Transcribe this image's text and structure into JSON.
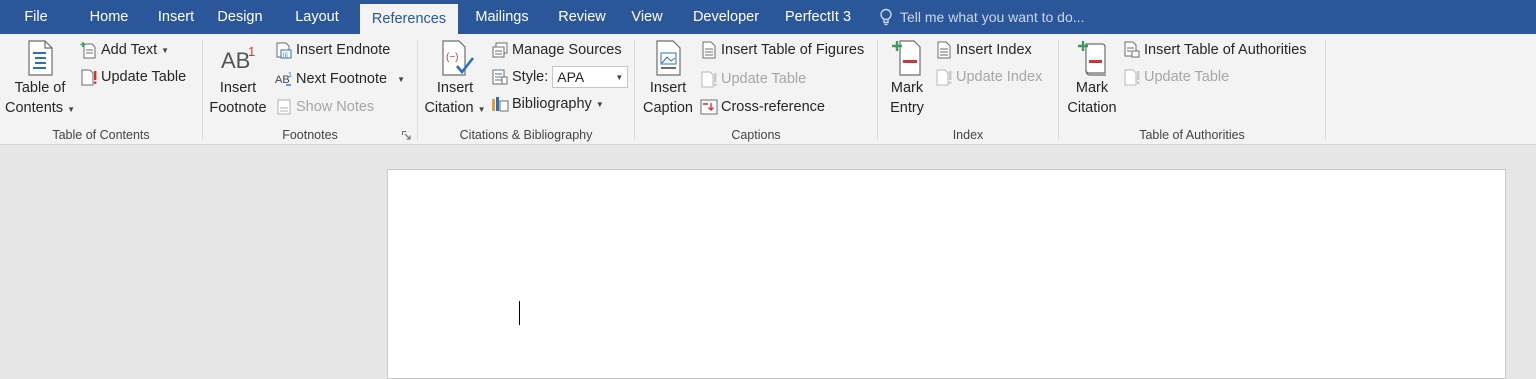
{
  "tabs": [
    {
      "label": "File",
      "active": false
    },
    {
      "label": "Home",
      "active": false
    },
    {
      "label": "Insert",
      "active": false
    },
    {
      "label": "Design",
      "active": false
    },
    {
      "label": "Layout",
      "active": false
    },
    {
      "label": "References",
      "active": true
    },
    {
      "label": "Mailings",
      "active": false
    },
    {
      "label": "Review",
      "active": false
    },
    {
      "label": "View",
      "active": false
    },
    {
      "label": "Developer",
      "active": false
    },
    {
      "label": "PerfectIt 3",
      "active": false
    }
  ],
  "tell_me": {
    "placeholder": "Tell me what you want to do...",
    "icon": "lightbulb-icon"
  },
  "colors": {
    "tab_bar": "#2b579a",
    "ribbon": "#f3f3f3",
    "accent_red": "#d13438",
    "accent_green": "#3a9a5b",
    "accent_blue": "#2b6fc2"
  },
  "groups": {
    "toc": {
      "label": "Table of Contents",
      "table_of_contents": {
        "line1": "Table of",
        "line2": "Contents"
      },
      "add_text": "Add Text",
      "update_table": "Update Table"
    },
    "footnotes": {
      "label": "Footnotes",
      "insert_footnote": {
        "line1": "Insert",
        "line2": "Footnote"
      },
      "insert_endnote": "Insert Endnote",
      "next_footnote": "Next Footnote",
      "show_notes": "Show Notes"
    },
    "citations": {
      "label": "Citations & Bibliography",
      "insert_citation": {
        "line1": "Insert",
        "line2": "Citation"
      },
      "manage_sources": "Manage Sources",
      "style_label": "Style:",
      "style_value": "APA",
      "bibliography": "Bibliography"
    },
    "captions": {
      "label": "Captions",
      "insert_caption": {
        "line1": "Insert",
        "line2": "Caption"
      },
      "insert_table_of_figures": "Insert Table of Figures",
      "update_table": "Update Table",
      "cross_reference": "Cross-reference"
    },
    "index": {
      "label": "Index",
      "mark_entry": {
        "line1": "Mark",
        "line2": "Entry"
      },
      "insert_index": "Insert Index",
      "update_index": "Update Index"
    },
    "authorities": {
      "label": "Table of Authorities",
      "mark_citation": {
        "line1": "Mark",
        "line2": "Citation"
      },
      "insert_table_of_authorities": "Insert Table of Authorities",
      "update_table": "Update Table"
    }
  }
}
